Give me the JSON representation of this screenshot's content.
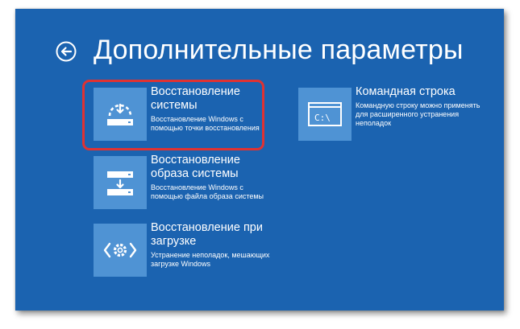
{
  "header": {
    "title": "Дополнительные параметры",
    "back_icon": "back-arrow-icon"
  },
  "tiles": [
    {
      "title_line1": "Восстановление",
      "title_line2": "системы",
      "desc_line1": "Восстановление Windows с",
      "desc_line2": "помощью точки восстановления",
      "icon": "system-restore-icon"
    },
    {
      "title_line1": "Командная строка",
      "desc_line1": "Командную строку можно применять",
      "desc_line2": "для расширенного устранения",
      "desc_line3": "неполадок",
      "icon": "command-prompt-icon",
      "icon_text": "C:\\"
    },
    {
      "title_line1": "Восстановление",
      "title_line2": "образа системы",
      "desc_line1": "Восстановление Windows с",
      "desc_line2": "помощью файла образа системы",
      "icon": "system-image-icon"
    },
    {
      "title_line1": "Восстановление при",
      "title_line2": "загрузке",
      "desc_line1": "Устранение неполадок, мешающих",
      "desc_line2": "загрузке Windows",
      "icon": "startup-repair-icon"
    }
  ],
  "colors": {
    "background": "#1b63b0",
    "tile": "#4f93d4",
    "highlight": "#e03232",
    "text": "#ffffff"
  }
}
